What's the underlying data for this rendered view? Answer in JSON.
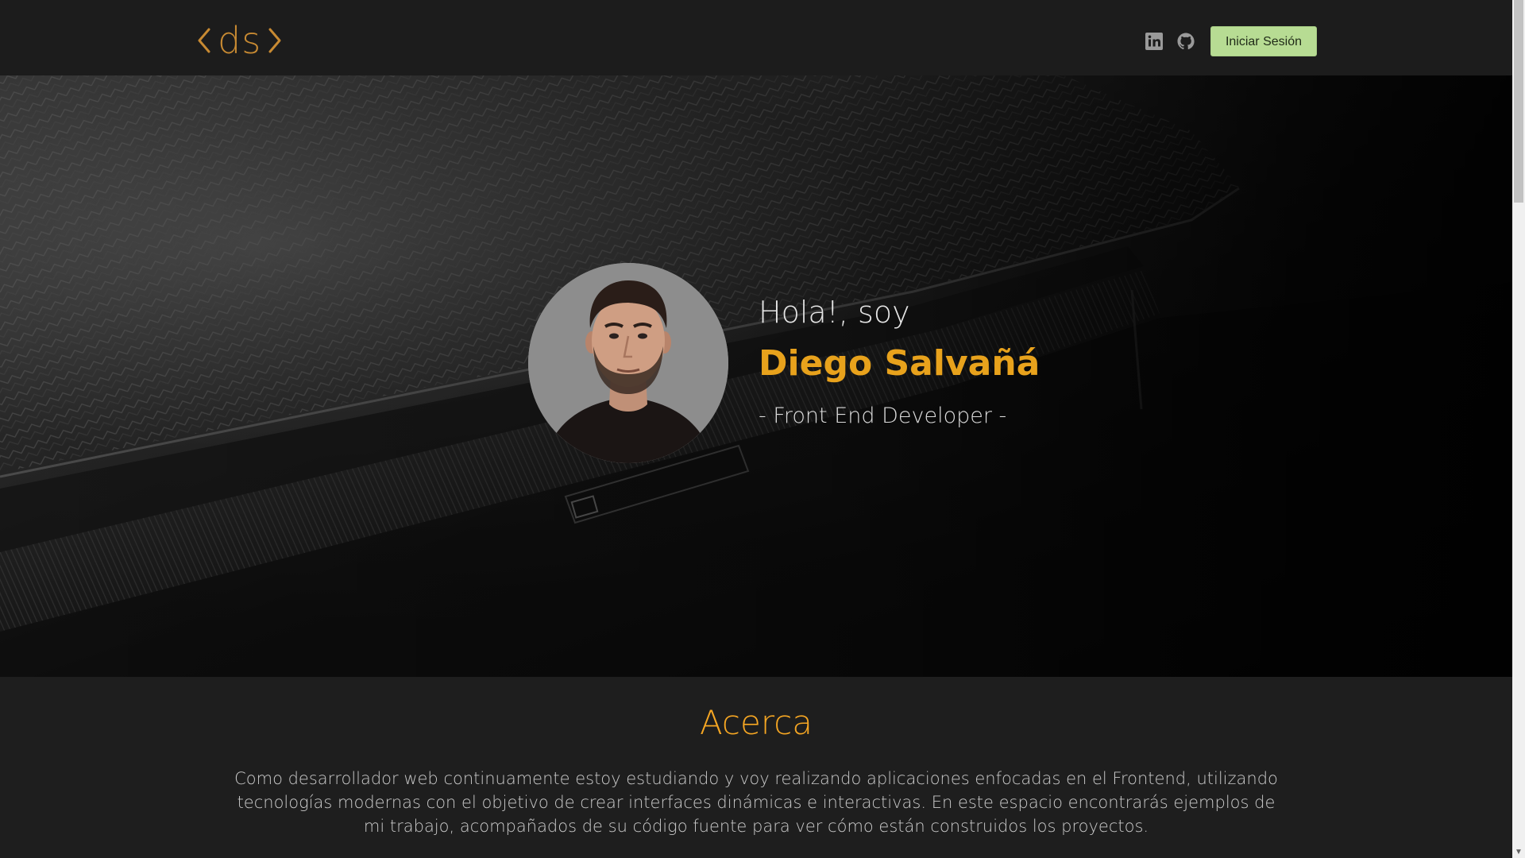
{
  "header": {
    "logo_text": "ds",
    "login_label": "Iniciar Sesión",
    "icons": [
      "linkedin-icon",
      "github-icon"
    ]
  },
  "hero": {
    "greeting": "Hola!, soy",
    "name": "Diego Salvañá",
    "role": "- Front End Developer -"
  },
  "about": {
    "title": "Acerca",
    "text": "Como desarrollador web continuamente estoy estudiando y voy realizando aplicaciones enfocadas en el Frontend, utilizando tecnologías modernas con el objetivo de crear interfaces dinámicas e interactivas. En este espacio encontrarás ejemplos de mi trabajo, acompañados de su código fuente para ver cómo están construidos los proyectos."
  },
  "colors": {
    "accent": "#e8a21c",
    "logo": "#c88a32",
    "button_bg": "#b7dc93",
    "navbar_bg": "#1c1c1c"
  }
}
